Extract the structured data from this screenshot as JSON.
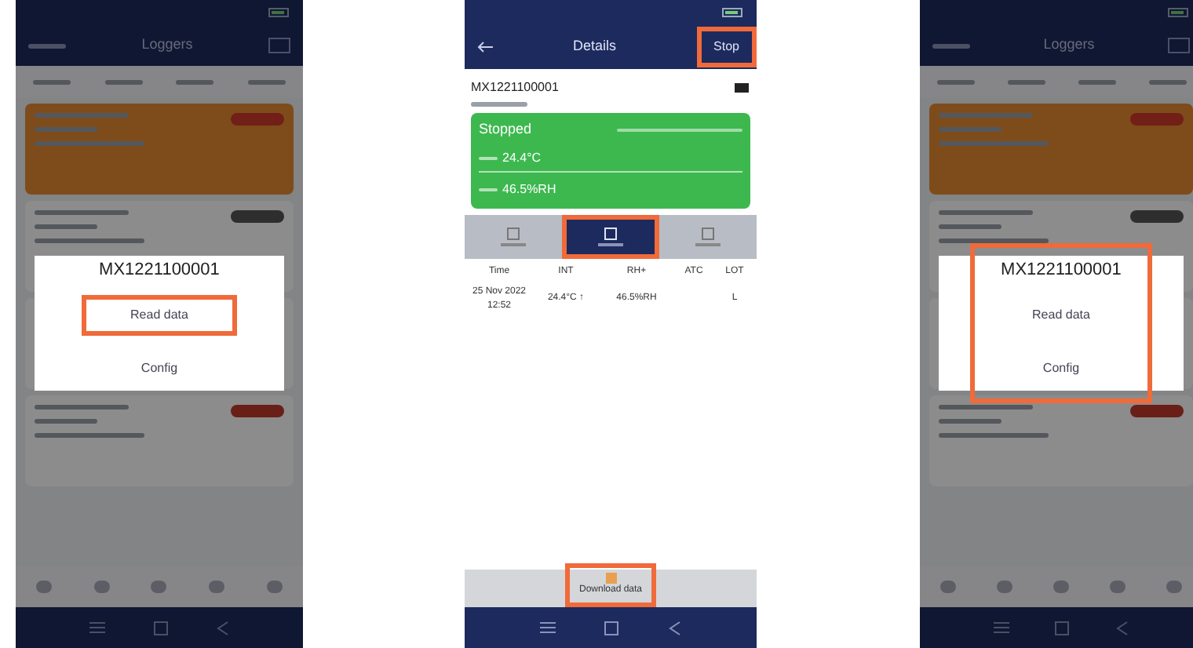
{
  "screens": [
    {
      "kind": "loggers",
      "title": "Loggers",
      "dialog": {
        "title": "MX1221100001",
        "highlighted": false,
        "options": [
          {
            "label": "Read data",
            "highlighted": true
          },
          {
            "label": "Config",
            "highlighted": false
          }
        ]
      }
    },
    {
      "kind": "details",
      "title": "Details",
      "action": {
        "label": "Stop",
        "highlighted": true
      },
      "device_id": "MX1221100001",
      "status": "Stopped",
      "readings": [
        "24.4°C",
        "46.5%RH"
      ],
      "tabs": [
        {
          "selected": false,
          "highlighted": false
        },
        {
          "selected": true,
          "highlighted": true
        },
        {
          "selected": false,
          "highlighted": false
        }
      ],
      "columns": [
        "Time",
        "INT",
        "RH+",
        "ATC",
        "LOT"
      ],
      "rows": [
        {
          "time": "25 Nov 2022 12:52",
          "int": "24.4°C ↑",
          "rh": "46.5%RH",
          "lot": "L"
        }
      ],
      "download": {
        "label": "Download data",
        "highlighted": true
      }
    },
    {
      "kind": "loggers",
      "title": "Loggers",
      "dialog": {
        "title": "MX1221100001",
        "highlighted": true,
        "options": [
          {
            "label": "Read data",
            "highlighted": false
          },
          {
            "label": "Config",
            "highlighted": false
          }
        ]
      }
    }
  ]
}
